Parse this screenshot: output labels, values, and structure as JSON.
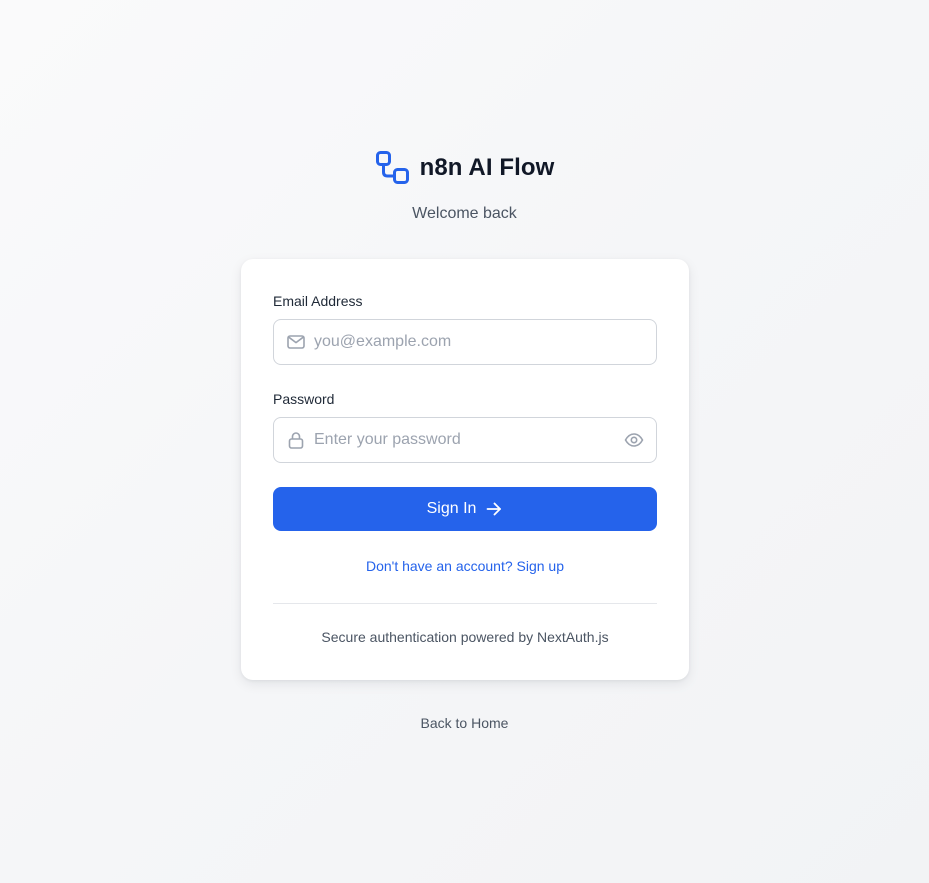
{
  "brand": {
    "logo_icon": "workflow-icon",
    "title": "n8n AI Flow",
    "subtitle": "Welcome back"
  },
  "form": {
    "email": {
      "label": "Email Address",
      "placeholder": "you@example.com",
      "value": "",
      "icon": "mail-icon"
    },
    "password": {
      "label": "Password",
      "placeholder": "Enter your password",
      "value": "",
      "icon": "lock-icon",
      "toggle_icon": "eye-icon"
    },
    "submit_label": "Sign In",
    "submit_icon": "arrow-right-icon",
    "signup_link": "Don't have an account? Sign up",
    "footer_note": "Secure authentication powered by NextAuth.js"
  },
  "back_link": "Back to Home",
  "colors": {
    "accent": "#2563eb",
    "text_primary": "#111827",
    "text_muted": "#4b5563",
    "placeholder": "#9ca3af",
    "border": "#d1d5db",
    "page_background": "#f5f6f8"
  }
}
